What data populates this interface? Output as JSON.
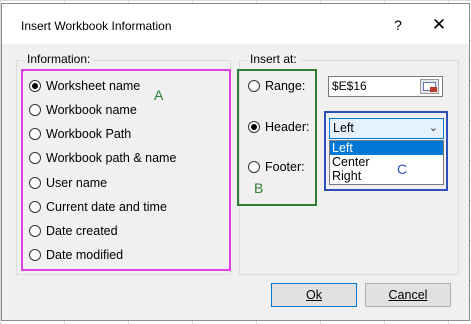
{
  "dialog": {
    "title": "Insert Workbook Information",
    "help_glyph": "?",
    "close_glyph": "✕"
  },
  "information": {
    "label": "Information:",
    "options": [
      {
        "label": "Worksheet name",
        "checked": true
      },
      {
        "label": "Workbook name",
        "checked": false
      },
      {
        "label": "Workbook Path",
        "checked": false
      },
      {
        "label": "Workbook path & name",
        "checked": false
      },
      {
        "label": "User name",
        "checked": false
      },
      {
        "label": "Current date and time",
        "checked": false
      },
      {
        "label": "Date created",
        "checked": false
      },
      {
        "label": "Date modified",
        "checked": false
      }
    ]
  },
  "insert_at": {
    "label": "Insert at:",
    "range_label": "Range:",
    "header_label": "Header:",
    "footer_label": "Footer:",
    "range_value": "$E$16",
    "selected": "Header"
  },
  "header_position": {
    "selected": "Left",
    "options": [
      "Left",
      "Center",
      "Right"
    ]
  },
  "annotations": {
    "a": "A",
    "b": "B",
    "c": "C",
    "magenta": "#e040e0",
    "green": "#2e7d32",
    "blue": "#2e4fb8"
  },
  "buttons": {
    "ok": "Ok",
    "cancel": "Cancel"
  }
}
